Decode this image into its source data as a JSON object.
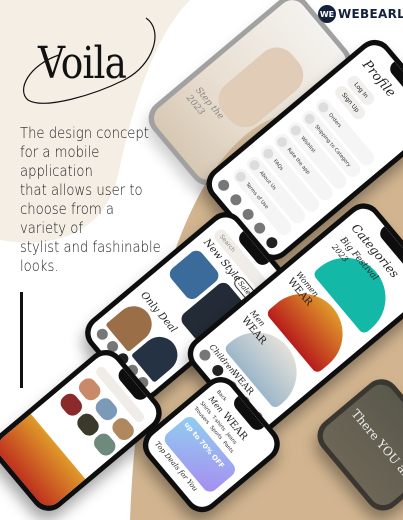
{
  "brand": {
    "logo_mark": "WE",
    "logo_text": "WEBEARL"
  },
  "hero": {
    "title": "Voila",
    "description": [
      "The design concept",
      "for a mobile",
      "application",
      "that allows user to",
      "choose from a",
      "variety of",
      "stylist and fashinable",
      "looks."
    ]
  },
  "colors": {
    "beige": "#f4eee5",
    "tan": "#d2b590",
    "navy": "#14213d"
  },
  "phone_intro": {
    "caption": "Step the",
    "year": "2023"
  },
  "phone_profile": {
    "title": "Profile",
    "login": "Log In",
    "signup": "Sign Up",
    "items": [
      "Orders",
      "Shipping to Category",
      "Wishlist",
      "Rate the app",
      "FAQs",
      "About Us",
      "Terms of Use"
    ]
  },
  "phone_home": {
    "search": "Search",
    "new_style": "New Style",
    "sale": "Sale",
    "deal": "Only Deal"
  },
  "phone_categories": {
    "title": "Categories",
    "festival": "Big Festival",
    "festival_year": "2023",
    "women": "Women",
    "men": "Men",
    "children": "Children",
    "wear": "WEAR"
  },
  "phone_men": {
    "back": "Back",
    "brand_top": "Men",
    "brand": "WEAR",
    "tabs": [
      "Shirts",
      "T-shirts",
      "Jeans",
      "Trousers",
      "Sports",
      "Pants"
    ],
    "offer": "up to 70% OFF",
    "deals": "Top Deals for You"
  },
  "phone_splash": {
    "text": "There YOU are"
  }
}
